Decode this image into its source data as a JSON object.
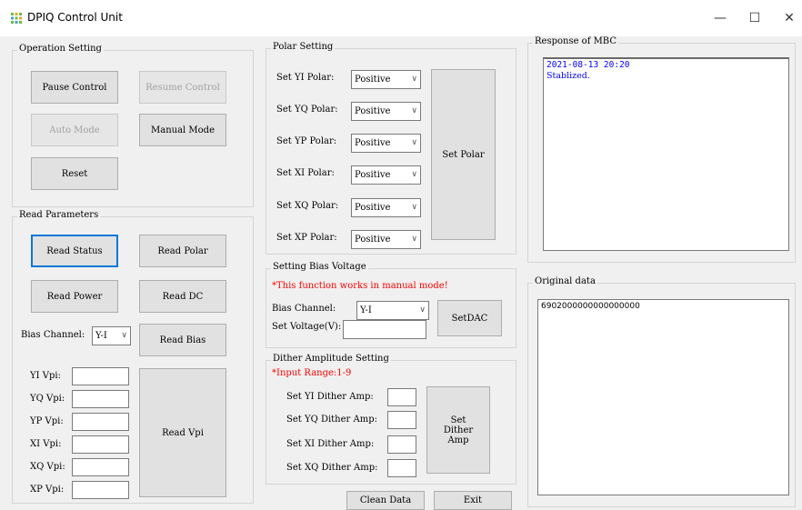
{
  "window": {
    "title": "DPIQ Control Unit",
    "minimize": "—",
    "maximize": "☐",
    "close": "✕"
  },
  "operation": {
    "title": "Operation Setting",
    "pause": "Pause Control",
    "resume": "Resume Control",
    "auto": "Auto Mode",
    "manual": "Manual Mode",
    "reset": "Reset"
  },
  "read_params": {
    "title": "Read Parameters",
    "status": "Read Status",
    "polar": "Read Polar",
    "power": "Read Power",
    "dc": "Read DC",
    "bias_channel_label": "Bias Channel:",
    "bias_channel_value": "Y-I",
    "bias": "Read Bias",
    "vpi_button": "Read Vpi",
    "vpi_labels": [
      "YI Vpi:",
      "YQ Vpi:",
      "YP Vpi:",
      "XI Vpi:",
      "XQ Vpi:",
      "XP Vpi:"
    ]
  },
  "polar": {
    "title": "Polar Setting",
    "rows": [
      {
        "label": "Set YI Polar:",
        "value": "Positive"
      },
      {
        "label": "Set YQ Polar:",
        "value": "Positive"
      },
      {
        "label": "Set YP Polar:",
        "value": "Positive"
      },
      {
        "label": "Set XI Polar:",
        "value": "Positive"
      },
      {
        "label": "Set XQ Polar:",
        "value": "Positive"
      },
      {
        "label": "Set XP Polar:",
        "value": "Positive"
      }
    ],
    "button": "Set Polar"
  },
  "bias": {
    "title": "Setting Bias Voltage",
    "note": "*This function works in manual mode!",
    "channel_label": "Bias Channel:",
    "channel_value": "Y-I",
    "voltage_label": "Set Voltage(V):",
    "button": "SetDAC"
  },
  "dither": {
    "title": "Dither Amplitude Setting",
    "note": "*Input Range:1-9",
    "labels": [
      "Set YI Dither Amp:",
      "Set YQ Dither Amp:",
      "Set XI Dither Amp:",
      "Set XQ Dither Amp:"
    ],
    "button": "Set Dither Amp"
  },
  "footer": {
    "clean": "Clean Data",
    "exit": "Exit"
  },
  "response": {
    "title": "Response of MBC",
    "timestamp": "2021-08-13 20:20",
    "message": "Stablized."
  },
  "original": {
    "title": "Original data",
    "value": "6902000000000000000"
  },
  "colors": {
    "accent": "#0078d7",
    "warning": "#ff0000",
    "log_text": "#0000ff"
  }
}
